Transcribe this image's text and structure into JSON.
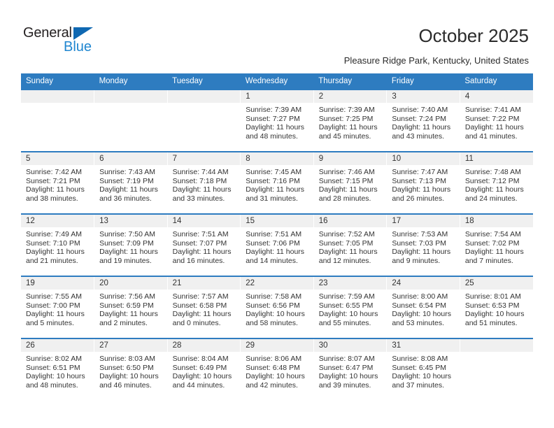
{
  "brand": {
    "name_part1": "General",
    "name_part2": "Blue",
    "triangle_color": "#0f68b2",
    "blue_color": "#1f86d0"
  },
  "header": {
    "title": "October 2025",
    "subtitle": "Pleasure Ridge Park, Kentucky, United States"
  },
  "theme": {
    "header_blue": "#2e7cc0",
    "daynum_band": "#f0f0f0",
    "text": "#333333"
  },
  "weekdays": [
    "Sunday",
    "Monday",
    "Tuesday",
    "Wednesday",
    "Thursday",
    "Friday",
    "Saturday"
  ],
  "weeks": [
    [
      {
        "day": "",
        "sunrise": "",
        "sunset": "",
        "daylight1": "",
        "daylight2": ""
      },
      {
        "day": "",
        "sunrise": "",
        "sunset": "",
        "daylight1": "",
        "daylight2": ""
      },
      {
        "day": "",
        "sunrise": "",
        "sunset": "",
        "daylight1": "",
        "daylight2": ""
      },
      {
        "day": "1",
        "sunrise": "Sunrise: 7:39 AM",
        "sunset": "Sunset: 7:27 PM",
        "daylight1": "Daylight: 11 hours",
        "daylight2": "and 48 minutes."
      },
      {
        "day": "2",
        "sunrise": "Sunrise: 7:39 AM",
        "sunset": "Sunset: 7:25 PM",
        "daylight1": "Daylight: 11 hours",
        "daylight2": "and 45 minutes."
      },
      {
        "day": "3",
        "sunrise": "Sunrise: 7:40 AM",
        "sunset": "Sunset: 7:24 PM",
        "daylight1": "Daylight: 11 hours",
        "daylight2": "and 43 minutes."
      },
      {
        "day": "4",
        "sunrise": "Sunrise: 7:41 AM",
        "sunset": "Sunset: 7:22 PM",
        "daylight1": "Daylight: 11 hours",
        "daylight2": "and 41 minutes."
      }
    ],
    [
      {
        "day": "5",
        "sunrise": "Sunrise: 7:42 AM",
        "sunset": "Sunset: 7:21 PM",
        "daylight1": "Daylight: 11 hours",
        "daylight2": "and 38 minutes."
      },
      {
        "day": "6",
        "sunrise": "Sunrise: 7:43 AM",
        "sunset": "Sunset: 7:19 PM",
        "daylight1": "Daylight: 11 hours",
        "daylight2": "and 36 minutes."
      },
      {
        "day": "7",
        "sunrise": "Sunrise: 7:44 AM",
        "sunset": "Sunset: 7:18 PM",
        "daylight1": "Daylight: 11 hours",
        "daylight2": "and 33 minutes."
      },
      {
        "day": "8",
        "sunrise": "Sunrise: 7:45 AM",
        "sunset": "Sunset: 7:16 PM",
        "daylight1": "Daylight: 11 hours",
        "daylight2": "and 31 minutes."
      },
      {
        "day": "9",
        "sunrise": "Sunrise: 7:46 AM",
        "sunset": "Sunset: 7:15 PM",
        "daylight1": "Daylight: 11 hours",
        "daylight2": "and 28 minutes."
      },
      {
        "day": "10",
        "sunrise": "Sunrise: 7:47 AM",
        "sunset": "Sunset: 7:13 PM",
        "daylight1": "Daylight: 11 hours",
        "daylight2": "and 26 minutes."
      },
      {
        "day": "11",
        "sunrise": "Sunrise: 7:48 AM",
        "sunset": "Sunset: 7:12 PM",
        "daylight1": "Daylight: 11 hours",
        "daylight2": "and 24 minutes."
      }
    ],
    [
      {
        "day": "12",
        "sunrise": "Sunrise: 7:49 AM",
        "sunset": "Sunset: 7:10 PM",
        "daylight1": "Daylight: 11 hours",
        "daylight2": "and 21 minutes."
      },
      {
        "day": "13",
        "sunrise": "Sunrise: 7:50 AM",
        "sunset": "Sunset: 7:09 PM",
        "daylight1": "Daylight: 11 hours",
        "daylight2": "and 19 minutes."
      },
      {
        "day": "14",
        "sunrise": "Sunrise: 7:51 AM",
        "sunset": "Sunset: 7:07 PM",
        "daylight1": "Daylight: 11 hours",
        "daylight2": "and 16 minutes."
      },
      {
        "day": "15",
        "sunrise": "Sunrise: 7:51 AM",
        "sunset": "Sunset: 7:06 PM",
        "daylight1": "Daylight: 11 hours",
        "daylight2": "and 14 minutes."
      },
      {
        "day": "16",
        "sunrise": "Sunrise: 7:52 AM",
        "sunset": "Sunset: 7:05 PM",
        "daylight1": "Daylight: 11 hours",
        "daylight2": "and 12 minutes."
      },
      {
        "day": "17",
        "sunrise": "Sunrise: 7:53 AM",
        "sunset": "Sunset: 7:03 PM",
        "daylight1": "Daylight: 11 hours",
        "daylight2": "and 9 minutes."
      },
      {
        "day": "18",
        "sunrise": "Sunrise: 7:54 AM",
        "sunset": "Sunset: 7:02 PM",
        "daylight1": "Daylight: 11 hours",
        "daylight2": "and 7 minutes."
      }
    ],
    [
      {
        "day": "19",
        "sunrise": "Sunrise: 7:55 AM",
        "sunset": "Sunset: 7:00 PM",
        "daylight1": "Daylight: 11 hours",
        "daylight2": "and 5 minutes."
      },
      {
        "day": "20",
        "sunrise": "Sunrise: 7:56 AM",
        "sunset": "Sunset: 6:59 PM",
        "daylight1": "Daylight: 11 hours",
        "daylight2": "and 2 minutes."
      },
      {
        "day": "21",
        "sunrise": "Sunrise: 7:57 AM",
        "sunset": "Sunset: 6:58 PM",
        "daylight1": "Daylight: 11 hours",
        "daylight2": "and 0 minutes."
      },
      {
        "day": "22",
        "sunrise": "Sunrise: 7:58 AM",
        "sunset": "Sunset: 6:56 PM",
        "daylight1": "Daylight: 10 hours",
        "daylight2": "and 58 minutes."
      },
      {
        "day": "23",
        "sunrise": "Sunrise: 7:59 AM",
        "sunset": "Sunset: 6:55 PM",
        "daylight1": "Daylight: 10 hours",
        "daylight2": "and 55 minutes."
      },
      {
        "day": "24",
        "sunrise": "Sunrise: 8:00 AM",
        "sunset": "Sunset: 6:54 PM",
        "daylight1": "Daylight: 10 hours",
        "daylight2": "and 53 minutes."
      },
      {
        "day": "25",
        "sunrise": "Sunrise: 8:01 AM",
        "sunset": "Sunset: 6:53 PM",
        "daylight1": "Daylight: 10 hours",
        "daylight2": "and 51 minutes."
      }
    ],
    [
      {
        "day": "26",
        "sunrise": "Sunrise: 8:02 AM",
        "sunset": "Sunset: 6:51 PM",
        "daylight1": "Daylight: 10 hours",
        "daylight2": "and 48 minutes."
      },
      {
        "day": "27",
        "sunrise": "Sunrise: 8:03 AM",
        "sunset": "Sunset: 6:50 PM",
        "daylight1": "Daylight: 10 hours",
        "daylight2": "and 46 minutes."
      },
      {
        "day": "28",
        "sunrise": "Sunrise: 8:04 AM",
        "sunset": "Sunset: 6:49 PM",
        "daylight1": "Daylight: 10 hours",
        "daylight2": "and 44 minutes."
      },
      {
        "day": "29",
        "sunrise": "Sunrise: 8:06 AM",
        "sunset": "Sunset: 6:48 PM",
        "daylight1": "Daylight: 10 hours",
        "daylight2": "and 42 minutes."
      },
      {
        "day": "30",
        "sunrise": "Sunrise: 8:07 AM",
        "sunset": "Sunset: 6:47 PM",
        "daylight1": "Daylight: 10 hours",
        "daylight2": "and 39 minutes."
      },
      {
        "day": "31",
        "sunrise": "Sunrise: 8:08 AM",
        "sunset": "Sunset: 6:45 PM",
        "daylight1": "Daylight: 10 hours",
        "daylight2": "and 37 minutes."
      },
      {
        "day": "",
        "sunrise": "",
        "sunset": "",
        "daylight1": "",
        "daylight2": ""
      }
    ]
  ]
}
